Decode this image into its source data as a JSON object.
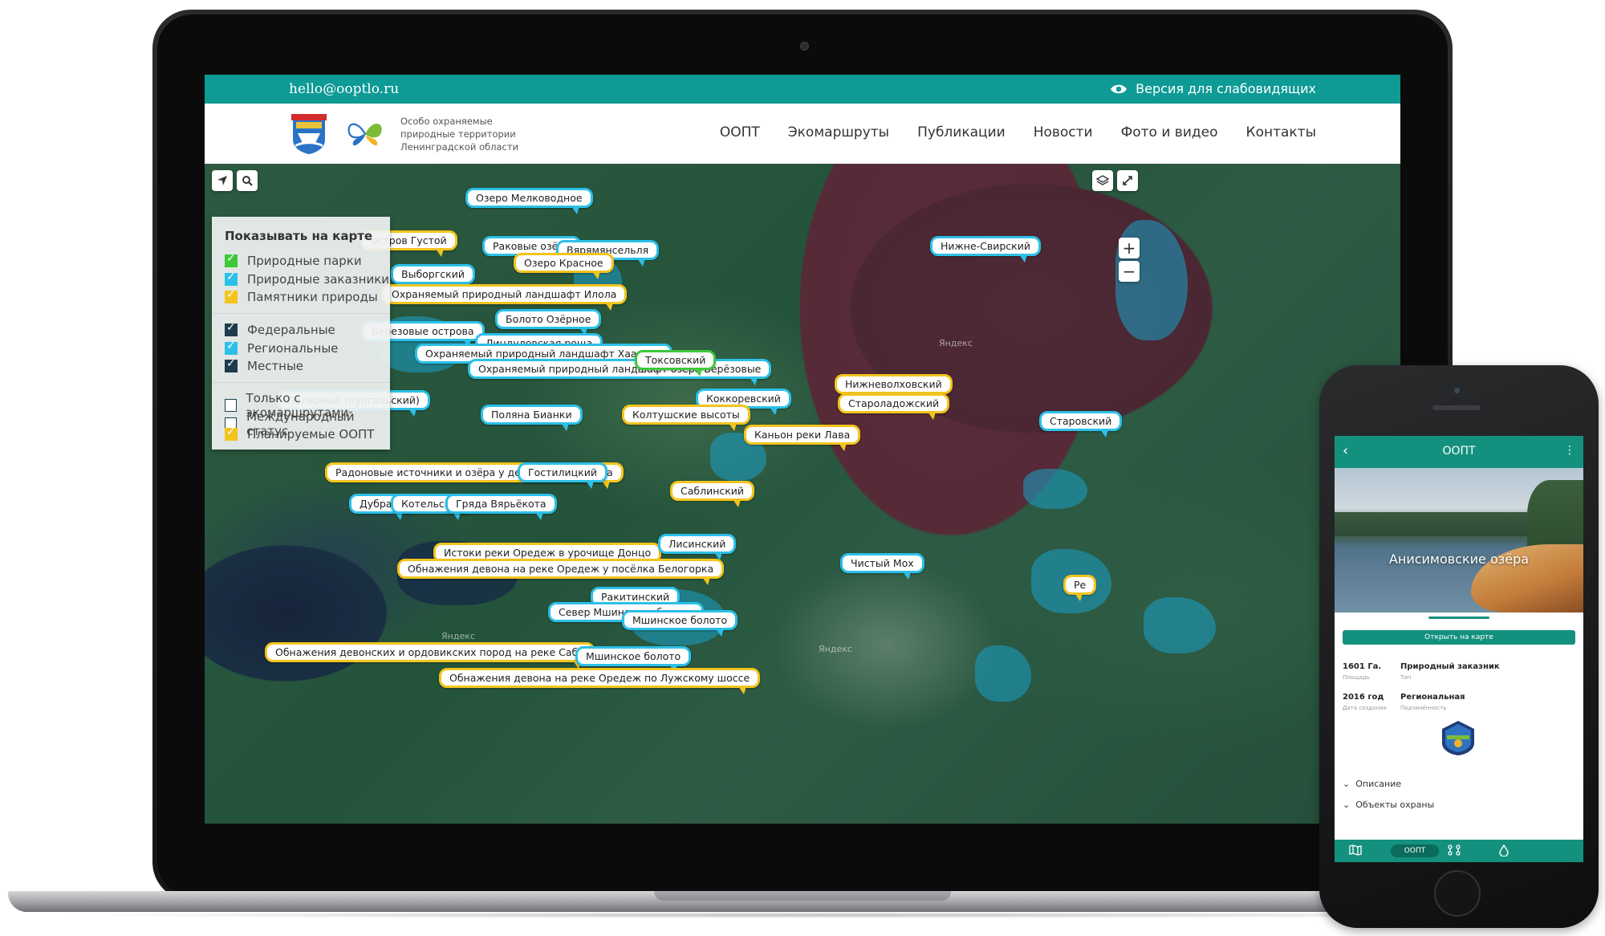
{
  "site": {
    "email": "hello@ooptlo.ru",
    "vision_label": "Версия для слабовидящих",
    "org_name": [
      "Особо охраняемые",
      "природные территории",
      "Ленинградской области"
    ],
    "nav": [
      "ООПТ",
      "Экомаршруты",
      "Публикации",
      "Новости",
      "Фото и видео",
      "Контакты"
    ],
    "accent_color": "#0e9a95"
  },
  "map": {
    "watermark": "Яндекс",
    "controls": {
      "locate": "locate-icon",
      "search": "search-icon",
      "layers": "layers-icon",
      "fullscreen": "fullscreen-icon",
      "zoom_in": "+",
      "zoom_out": "−"
    },
    "filter": {
      "title": "Показывать на карте",
      "group1": [
        {
          "label": "Природные парки",
          "checked": true,
          "color": "#3fc93a"
        },
        {
          "label": "Природные заказники",
          "checked": true,
          "color": "#2cc0e8"
        },
        {
          "label": "Памятники природы",
          "checked": true,
          "color": "#f3c41e"
        }
      ],
      "group2": [
        {
          "label": "Федеральные",
          "checked": true,
          "color": "#1d3d4c"
        },
        {
          "label": "Региональные",
          "checked": true,
          "color": "#2cc0e8"
        },
        {
          "label": "Местные",
          "checked": true,
          "color": "#1d3d4c"
        }
      ],
      "group3": [
        {
          "label": "Только с экомаршрутами",
          "checked": false,
          "color": "#ffffff"
        },
        {
          "label": "Международный статус",
          "checked": false,
          "color": "#ffffff"
        },
        {
          "label": "Планируемые ООПТ",
          "checked": true,
          "color": "#f3c41e"
        }
      ]
    },
    "labels": [
      {
        "text": "Озеро Мелководное",
        "type": "blue"
      },
      {
        "text": "остров Густой",
        "type": "yellow"
      },
      {
        "text": "Раковые озёра",
        "type": "blue"
      },
      {
        "text": "Вярямянсельля",
        "type": "blue"
      },
      {
        "text": "Озеро Красное",
        "type": "yellow"
      },
      {
        "text": "Выборгский",
        "type": "blue"
      },
      {
        "text": "Охраняемый природный ландшафт Илола",
        "type": "yellow"
      },
      {
        "text": "Болото Озёрное",
        "type": "blue"
      },
      {
        "text": "Березовые острова",
        "type": "blue"
      },
      {
        "text": "Линдуловская роща",
        "type": "blue"
      },
      {
        "text": "Охраняемый природный ландшафт Хаапала",
        "type": "blue"
      },
      {
        "text": "Охраняемый природный ландшафт озера Берёзовые",
        "type": "blue"
      },
      {
        "text": "Токсовский",
        "type": "green"
      },
      {
        "text": "Коккоревский",
        "type": "blue"
      },
      {
        "text": "Полярный (Кургальский)",
        "type": "blue"
      },
      {
        "text": "Поляна Бианки",
        "type": "blue"
      },
      {
        "text": "Колтушские высоты",
        "type": "yellow"
      },
      {
        "text": "Каньон реки Лава",
        "type": "yellow"
      },
      {
        "text": "Нижне-Свирский",
        "type": "blue"
      },
      {
        "text": "Нижневолховский",
        "type": "yellow"
      },
      {
        "text": "Староладожский",
        "type": "yellow"
      },
      {
        "text": "Старовский",
        "type": "blue"
      },
      {
        "text": "Радоновые источники и озёра у деревни Лопухинка",
        "type": "yellow"
      },
      {
        "text": "Гостилицкий",
        "type": "blue"
      },
      {
        "text": "Саблинский",
        "type": "yellow"
      },
      {
        "text": "Дубравы",
        "type": "blue"
      },
      {
        "text": "Котельский",
        "type": "blue"
      },
      {
        "text": "Гряда Вярьёкота",
        "type": "blue"
      },
      {
        "text": "Истоки реки Оредеж в урочище Донцо",
        "type": "yellow"
      },
      {
        "text": "Лисинский",
        "type": "blue"
      },
      {
        "text": "Обнажения девона на реке Оредеж у посёлка Белогорка",
        "type": "yellow"
      },
      {
        "text": "Чистый Мох",
        "type": "blue"
      },
      {
        "text": "Ракитинский",
        "type": "blue"
      },
      {
        "text": "Север Мшинского болота",
        "type": "blue"
      },
      {
        "text": "Мшинское болото",
        "type": "blue"
      },
      {
        "text": "Обнажения девонских и ордовикских пород на реке Саба",
        "type": "yellow"
      },
      {
        "text": "Мшинское болото",
        "type": "blue"
      },
      {
        "text": "Обнажения девона на реке Оредеж по Лужскому шоссе",
        "type": "yellow"
      },
      {
        "text": "Ре",
        "type": "yellow"
      }
    ]
  },
  "phone": {
    "header_title": "ООПТ",
    "hero_title": "Анисимовские озёра",
    "open_on_map": "Открыть на карте",
    "facts": [
      {
        "value": "1601 Га.",
        "label": "Площадь"
      },
      {
        "value": "Природный заказник",
        "label": "Тип"
      },
      {
        "value": "2016 год",
        "label": "Дата создания"
      },
      {
        "value": "Региональная",
        "label": "Подчинённость"
      }
    ],
    "accordion": [
      "Описание",
      "Объекты охраны"
    ],
    "tabs": {
      "map": "map-icon",
      "active": "ООПТ",
      "routes": "routes-icon",
      "drop": "drop-icon"
    }
  }
}
